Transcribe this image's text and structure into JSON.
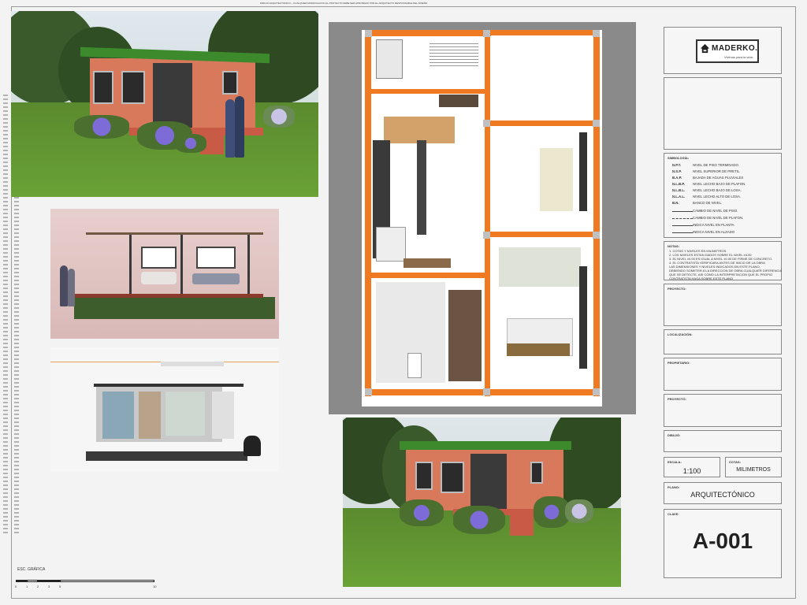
{
  "header_note": "DIBUJO ARQUITECTONICO – CUALQUIER MODIFICACION AL PROYECTO DEBE SER APROBADO POR EL ARQUITECTO RESPONSABLE DEL DISEÑO",
  "title_block": {
    "logo_text": "MADERKO.",
    "logo_tagline": "Vivimos para la vida.",
    "symbology_title": "SIMBOLOGÍA:",
    "symbols": [
      {
        "code": "N.P.T.",
        "desc": "NIVEL DE PISO TERMINADO."
      },
      {
        "code": "N.S.P.",
        "desc": "NIVEL SUPERIOR DE PRETIL."
      },
      {
        "code": "B.A.P.",
        "desc": "BAJADA DE AGUAS PLUVIALES"
      },
      {
        "code": "N.L.B.P.",
        "desc": "NIVEL LECHO BAJO DE PLAFON"
      },
      {
        "code": "N.L.B.L.",
        "desc": "NIVEL LECHO BAJO DE LOSA."
      },
      {
        "code": "N.L.A.L.",
        "desc": "NIVEL LECHO ALTO DE LOSA."
      },
      {
        "code": "B.N.",
        "desc": "BANCO DE NIVEL."
      }
    ],
    "legend_items": [
      "CAMBIO DE NIVEL DE PISO.",
      "CAMBIO DE NIVEL DE PLAFON.",
      "INDICA NIVEL EN PLANTA",
      "INDICA NIVEL EN ALZADO"
    ],
    "notes_title": "NOTAS:",
    "notes": [
      "1. COTAS Y NIVELES EN MILIMETROS.",
      "2. LOS NIVELES ESTAN DADOS SOBRE EL NIVEL ±0.00",
      "3. EL NIVEL ±0.00 ES IGUAL A NIVEL ±0.00 DE FIRME DE CONCRETO.",
      "4. EL CONTRATISTA VERIFICARA ANTES DE INICIO DE LA OBRA",
      "LAS DIMENSIONES Y NIVELES INDICADOS EN ESTE PLANO,",
      "DEBIENDO SOMETER A LA DIRECCION DE OBRA CUALQUIER DIFERENCIA",
      "QUE SE DETECTE, ASI COMO LA INTERPRETACION QUE EL PROPIO",
      "CONTRATISTA HAGA SOBRE ESTE PLANO"
    ],
    "proyecto_label": "PROYECTO:",
    "localizacion_label": "LOCALIZACIÓN:",
    "propietario_label": "PROPIETARIO:",
    "proyecto2_label": "PROYECTÓ:",
    "dibujo_label": "DIBUJÓ:",
    "escala_label": "ESCALA:",
    "escala_value": "1:100",
    "cotas_label": "COTAS:",
    "cotas_value": "MILIMETROS",
    "plano_label": "PLANO:",
    "plano_value": "ARQUITECTÓNICO",
    "clave_label": "CLAVE:",
    "clave_value": "A-001"
  },
  "scale_bar": {
    "title": "ESC. GRÁFICA",
    "ticks": [
      "0",
      "1",
      "2",
      "3",
      "5",
      "10"
    ]
  },
  "colors": {
    "wall_orange": "#f07a22",
    "roof_green": "#3d8a2d",
    "house_terracotta": "#d8795c"
  }
}
